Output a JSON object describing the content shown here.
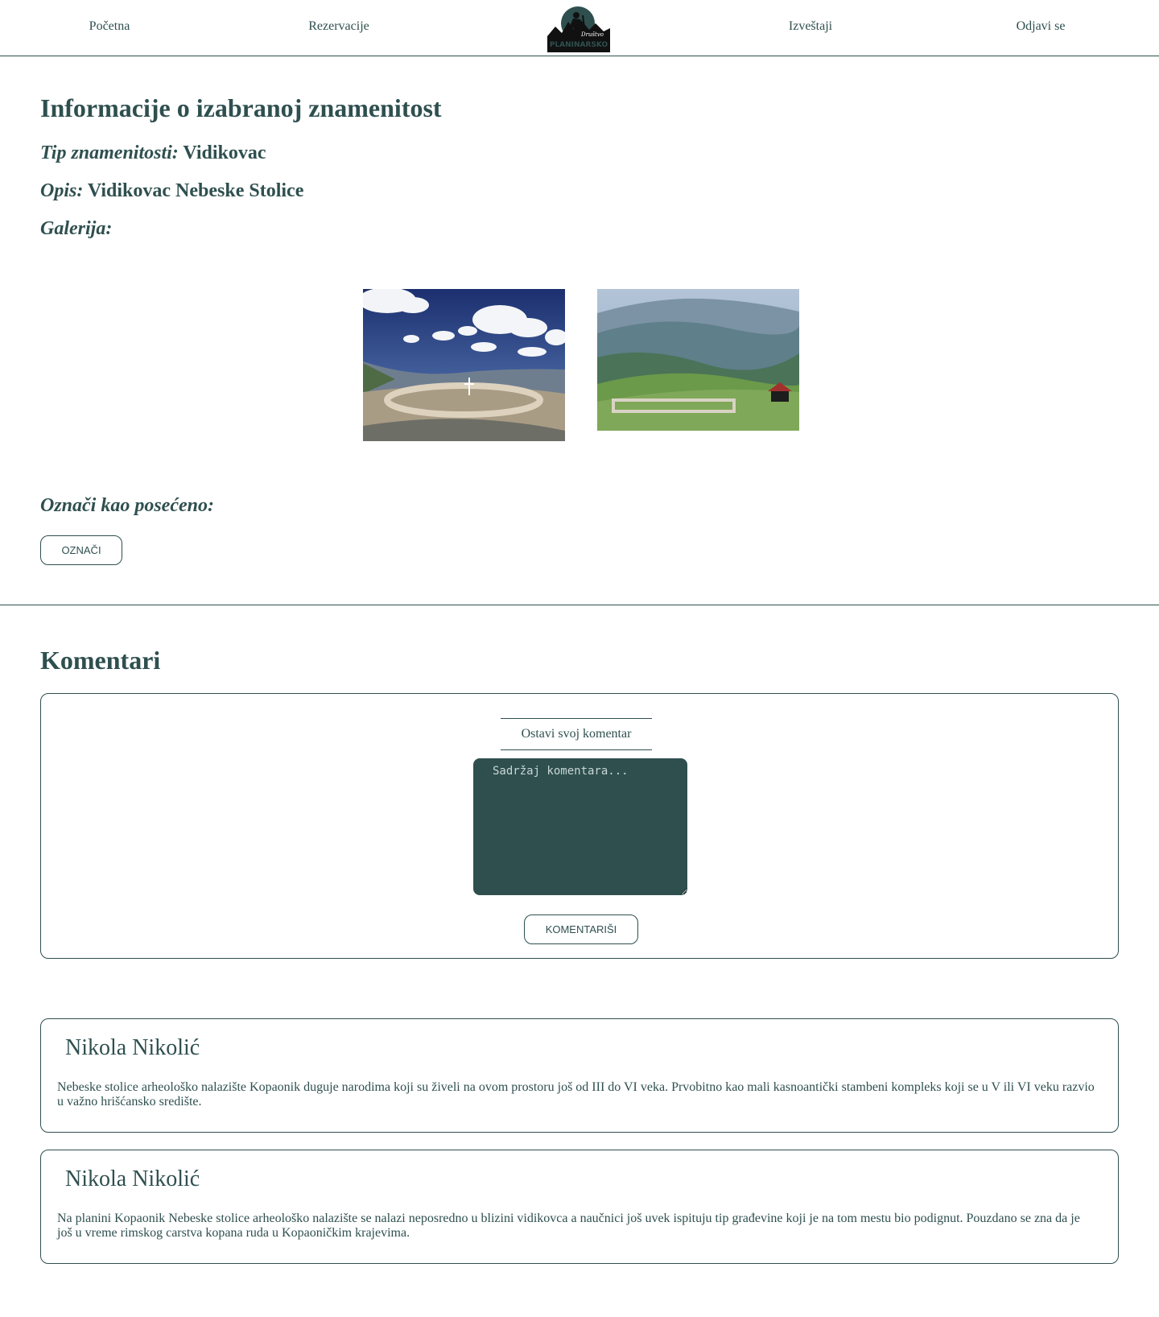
{
  "nav": {
    "home": "Početna",
    "reservations": "Rezervacije",
    "logo_text_top": "Društvo",
    "logo_text_main": "PLANINARSKO",
    "reports": "Izveštaji",
    "logout": "Odjavi se"
  },
  "landmark": {
    "heading": "Informacije o izabranoj znamenitost",
    "type_label": "Tip znamenitosti:",
    "type_value": "Vidikovac",
    "description_label": "Opis:",
    "description_value": "Vidikovac Nebeske Stolice",
    "gallery_label": "Galerija:",
    "gallery": [
      {
        "name": "gallery-image-1",
        "scene": "cloudy sky over stone ruins on a mountain top"
      },
      {
        "name": "gallery-image-2",
        "scene": "green hills with stone foundations and a small red-roofed hut"
      }
    ],
    "visit_label": "Označi kao posećeno:",
    "visit_button": "OZNAČI"
  },
  "comments": {
    "heading": "Komentari",
    "form_title": "Ostavi svoj komentar",
    "textarea_placeholder": "Sadržaj komentara...",
    "submit_button": "KOMENTARIŠI",
    "items": [
      {
        "author": "Nikola Nikolić",
        "text": "Nebeske stolice arheološko nalazište Kopaonik duguje narodima koji su živeli na ovom prostoru još od III do VI veka. Prvobitno kao mali kasnoantički stambeni kompleks koji se u V ili VI veku razvio u važno hrišćansko središte."
      },
      {
        "author": "Nikola Nikolić",
        "text": "Na planini Kopaonik Nebeske stolice arheološko nalazište se nalazi neposredno u blizini vidikovca a naučnici još uvek ispituju tip građevine koji je na tom mestu bio podignut. Pouzdano se zna da je još u vreme rimskog carstva kopana ruda u Kopaoničkim krajevima."
      }
    ]
  },
  "colors": {
    "primary": "#2f4f4f",
    "background": "#ffffff"
  }
}
